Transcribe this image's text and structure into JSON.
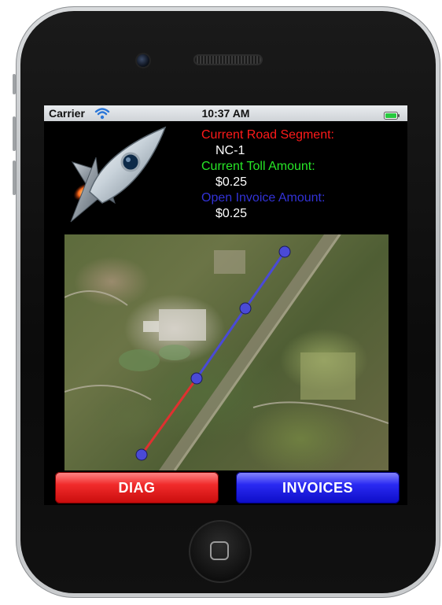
{
  "status_bar": {
    "carrier": "Carrier",
    "time": "10:37 AM",
    "wifi_icon": "wifi-icon",
    "battery_icon": "battery-full-icon"
  },
  "header": {
    "logo_icon": "rocket-icon"
  },
  "info": {
    "segment_label": "Current Road Segment:",
    "segment_value": "NC-1",
    "toll_label": "Current Toll Amount:",
    "toll_value": "$0.25",
    "invoice_label": "Open Invoice Amount:",
    "invoice_value": "$0.25"
  },
  "map": {
    "type": "satellite",
    "route_colors": {
      "traveled": "#e03030",
      "pending": "#4a4ad6"
    }
  },
  "buttons": {
    "diag_label": "DIAG",
    "invoices_label": "INVOICES"
  },
  "colors": {
    "segment_label": "#ff1a1a",
    "toll_label": "#27e627",
    "invoice_label": "#3232d6",
    "diag_button": "#e11b1b",
    "invoices_button": "#1b1be1"
  }
}
